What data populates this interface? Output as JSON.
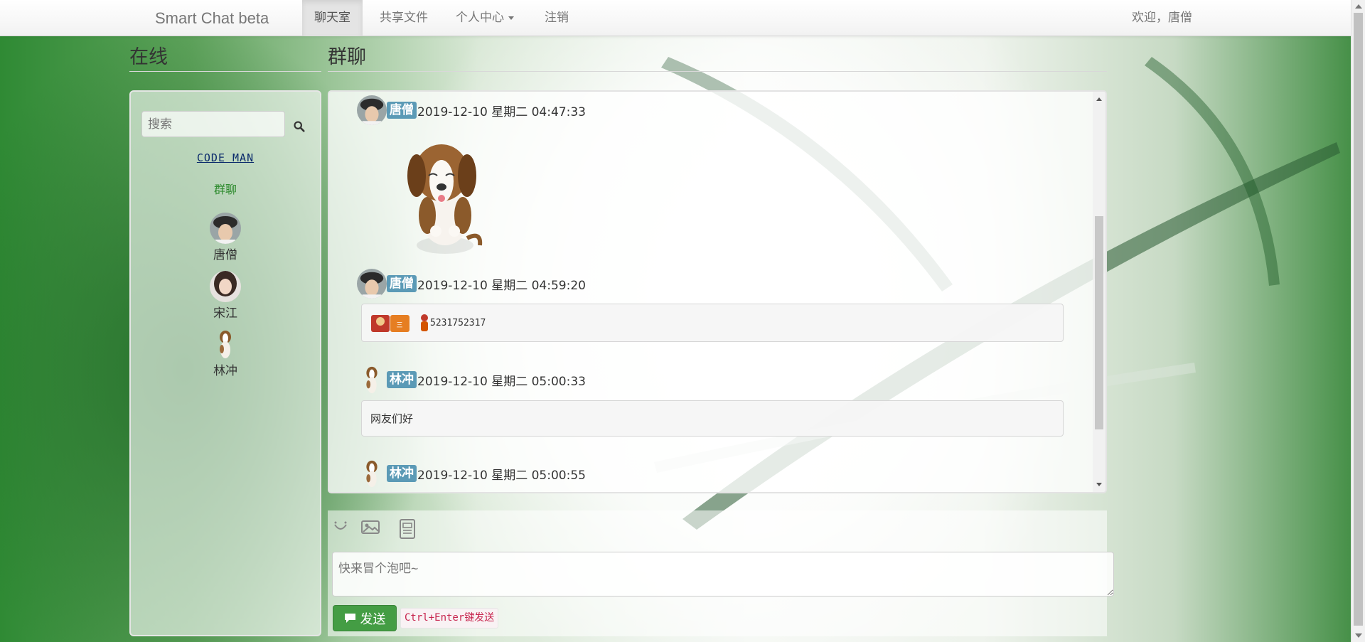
{
  "navbar": {
    "brand": "Smart Chat beta",
    "items": [
      {
        "label": "聊天室",
        "active": true
      },
      {
        "label": "共享文件",
        "active": false
      },
      {
        "label": "个人中心",
        "dropdown": true
      },
      {
        "label": "注销",
        "active": false
      }
    ],
    "welcome": "欢迎，唐僧"
  },
  "sidebar": {
    "heading": "在线",
    "search_placeholder": "搜索",
    "logo_text": "CODE MAN",
    "group_link": "群聊",
    "users": [
      {
        "name": "唐僧",
        "avatar": "person-cap-avatar"
      },
      {
        "name": "宋江",
        "avatar": "person-hair-avatar"
      },
      {
        "name": "林冲",
        "avatar": "dog-avatar"
      }
    ]
  },
  "chat": {
    "heading": "群聊",
    "messages": [
      {
        "user": "唐僧",
        "time": "2019-12-10 星期二 04:47:33",
        "type": "image",
        "content": "dog-sticker"
      },
      {
        "user": "唐僧",
        "time": "2019-12-10 星期二 04:59:20",
        "type": "text",
        "content": "5231752317"
      },
      {
        "user": "林冲",
        "time": "2019-12-10 星期二 05:00:33",
        "type": "text",
        "content": "网友们好"
      },
      {
        "user": "林冲",
        "time": "2019-12-10 星期二 05:00:55",
        "type": "text",
        "content": ""
      }
    ]
  },
  "composer": {
    "tools": [
      "smile-icon",
      "image-icon",
      "file-icon"
    ],
    "placeholder": "快来冒个泡吧~",
    "send_label": "发送",
    "hint": "Ctrl+Enter键发送"
  },
  "colors": {
    "badge": "#5b9ab6",
    "send": "#449d44",
    "group_link": "#2e8b2e"
  }
}
